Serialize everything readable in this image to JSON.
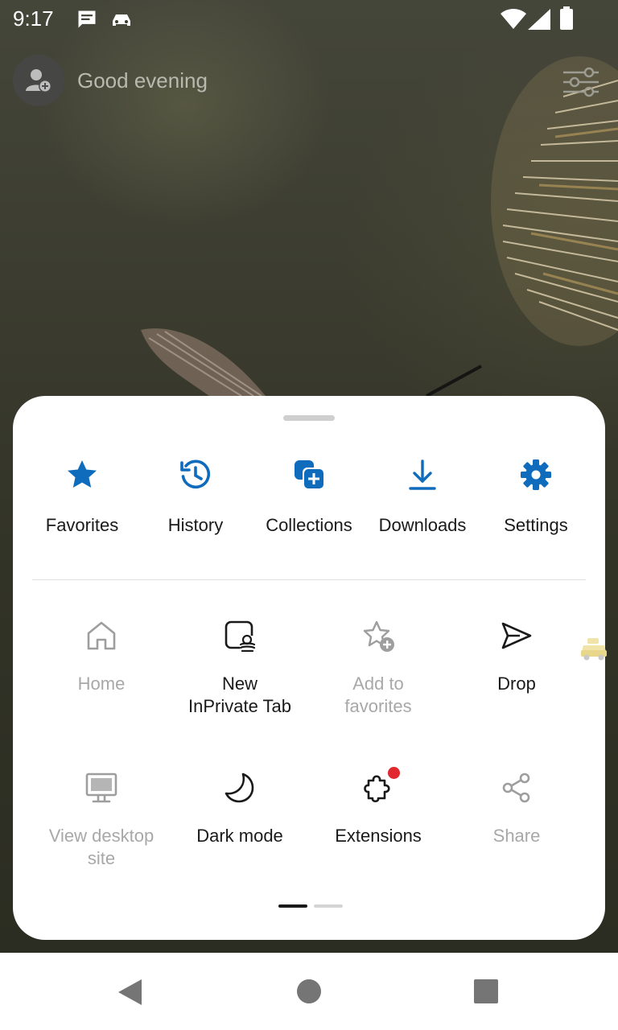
{
  "status_bar": {
    "time": "9:17",
    "icons": [
      "message-icon",
      "car-icon",
      "wifi-icon",
      "signal-icon",
      "battery-icon"
    ]
  },
  "header": {
    "greeting": "Good evening",
    "avatar_icon": "add-profile-icon",
    "customize_icon": "sliders-icon"
  },
  "menu": {
    "top_row": [
      {
        "label": "Favorites",
        "icon": "star-icon"
      },
      {
        "label": "History",
        "icon": "history-icon"
      },
      {
        "label": "Collections",
        "icon": "collections-icon"
      },
      {
        "label": "Downloads",
        "icon": "download-icon"
      },
      {
        "label": "Settings",
        "icon": "gear-icon"
      }
    ],
    "grid": [
      {
        "label": "Home",
        "icon": "home-icon",
        "enabled": false
      },
      {
        "label": "New\nInPrivate Tab",
        "icon": "inprivate-tab-icon",
        "enabled": true
      },
      {
        "label": "Add to\nfavorites",
        "icon": "add-favorite-icon",
        "enabled": false
      },
      {
        "label": "Drop",
        "icon": "send-icon",
        "enabled": true
      },
      {
        "label": "View desktop\nsite",
        "icon": "desktop-icon",
        "enabled": false
      },
      {
        "label": "Dark mode",
        "icon": "moon-icon",
        "enabled": true
      },
      {
        "label": "Extensions",
        "icon": "puzzle-icon",
        "enabled": true,
        "badge": true
      },
      {
        "label": "Share",
        "icon": "share-icon",
        "enabled": false
      }
    ],
    "page_indicator": {
      "pages": 2,
      "current": 1
    }
  },
  "colors": {
    "accent": "#0f6cbd",
    "sheet_bg": "#ffffff",
    "disabled_text": "#a8a8a8",
    "badge": "#e0282e"
  },
  "nav_bar": {
    "buttons": [
      "back-button",
      "home-button",
      "recents-button"
    ]
  }
}
